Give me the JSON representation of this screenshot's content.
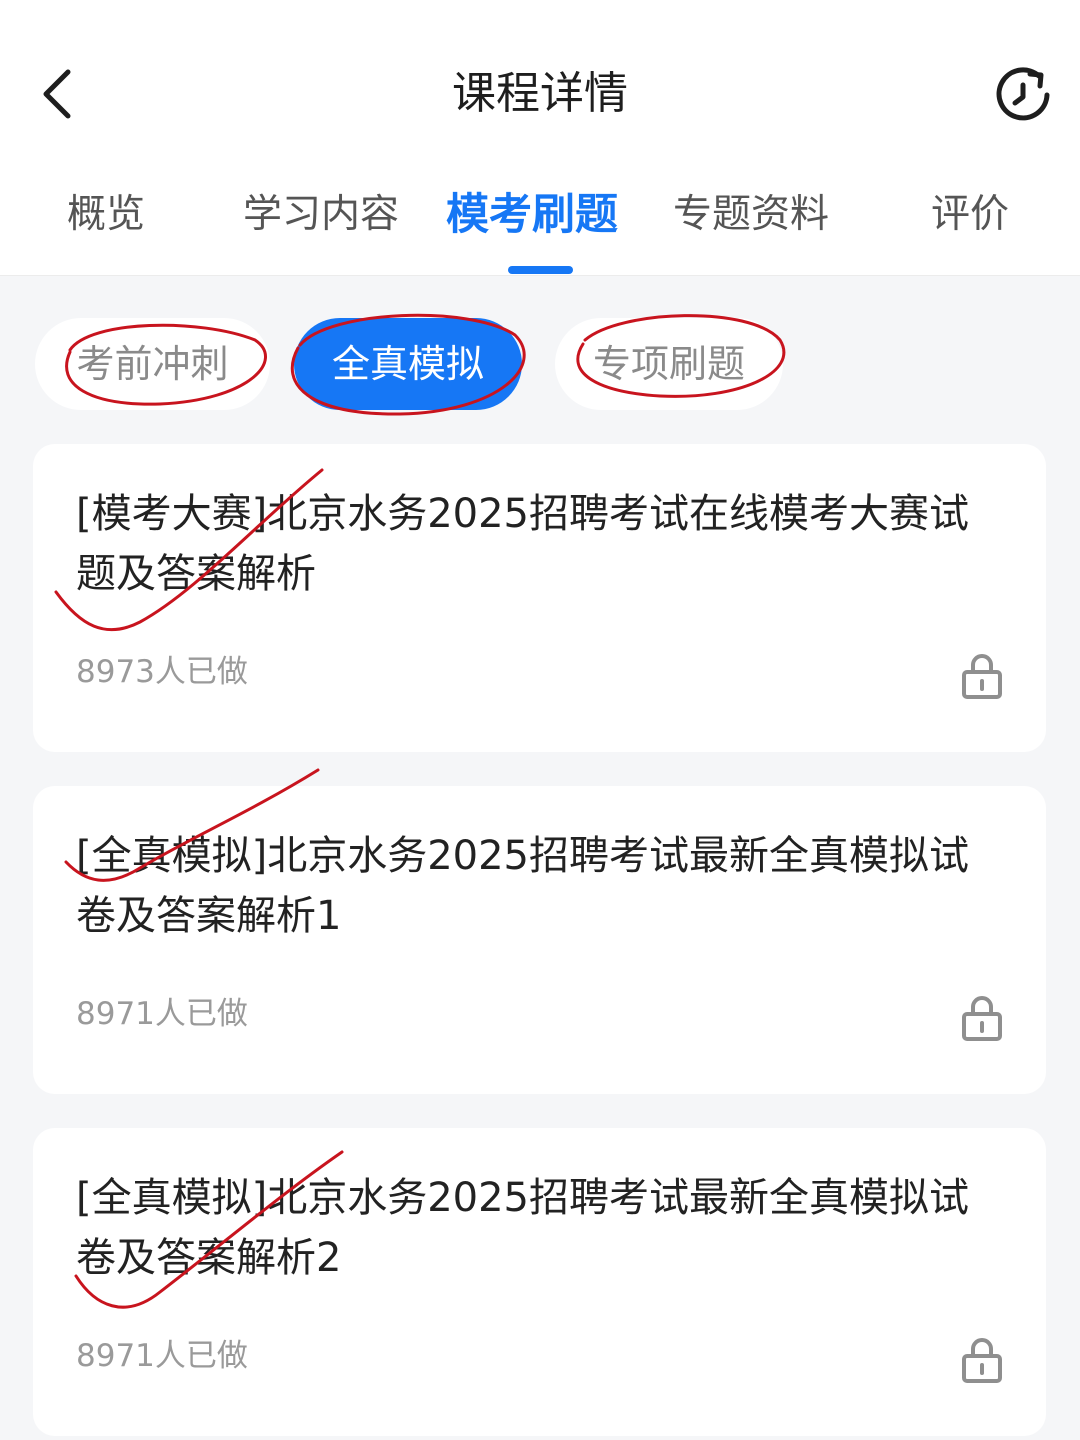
{
  "header": {
    "title": "课程详情"
  },
  "tabs": [
    {
      "label": "概览"
    },
    {
      "label": "学习内容"
    },
    {
      "label": "模考刷题"
    },
    {
      "label": "专题资料"
    },
    {
      "label": "评价"
    }
  ],
  "active_tab": "模考刷题",
  "filters": [
    {
      "label": "考前冲刺"
    },
    {
      "label": "全真模拟"
    },
    {
      "label": "专项刷题"
    }
  ],
  "active_filter": "全真模拟",
  "papers": [
    {
      "title": "[模考大赛]北京水务2025招聘考试在线模考大赛试题及答案解析",
      "count": "8973人已做"
    },
    {
      "title": "[全真模拟]北京水务2025招聘考试最新全真模拟试卷及答案解析1",
      "count": "8971人已做"
    },
    {
      "title": "[全真模拟]北京水务2025招聘考试最新全真模拟试卷及答案解析2",
      "count": "8971人已做"
    }
  ],
  "colors": {
    "accent": "#1677f5",
    "annotation": "#c8141e"
  }
}
